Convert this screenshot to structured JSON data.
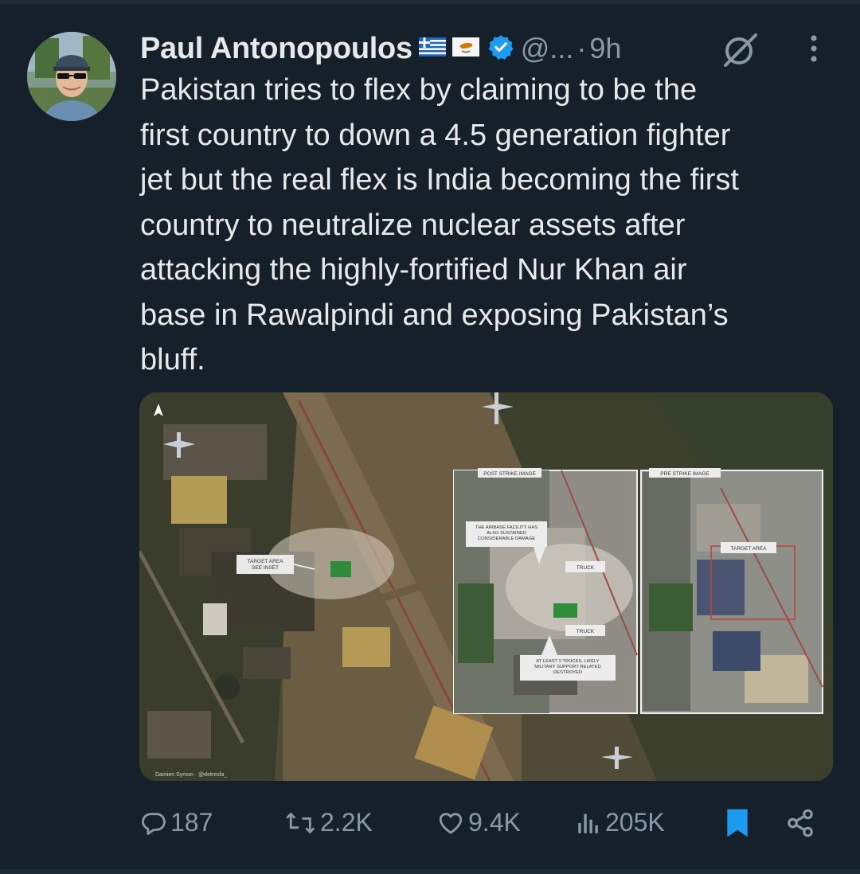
{
  "author": {
    "name": "Paul Antonopoulos",
    "handle": "@...",
    "separator": "·",
    "time": "9h",
    "flags": [
      "greece-flag-icon",
      "cyprus-flag-icon"
    ],
    "verified_icon": "verified-badge-icon"
  },
  "tweet": {
    "text": "Pakistan tries to flex by claiming to be the\nfirst country to down a 4.5 generation fighter\njet but the real flex is India becoming the first\ncountry to neutralize nuclear assets after\nattacking the highly-fortified Nur Khan air\nbase in Rawalpindi and exposing Pakistan’s\nbluff."
  },
  "media": {
    "inset_post_label": "POST STRIKE IMAGE",
    "inset_pre_label": "PRE STRIKE IMAGE",
    "target_area_see_inset": "TARGET AREA\nSEE INSET",
    "target_area": "TARGET AREA",
    "airbase_damage_note": "THE AIRBASE FACILITY HAS\nALSO SUSTAINED\nCONSIDERABLE DAMAGE",
    "truck_1": "TRUCK",
    "truck_2": "TRUCK",
    "trucks_note": "AT LEAST 2 TRUCKS, LIKELY\nMILITARY SUPPORT RELATED\nDESTROYED",
    "credit": "Damien Symon · @detresfa_"
  },
  "actions": {
    "replies": "187",
    "reposts": "2.2K",
    "likes": "9.4K",
    "views": "205K",
    "bookmark_color": "#1d9bf0",
    "icons": [
      "reply-icon",
      "repost-icon",
      "like-icon",
      "views-icon",
      "bookmark-icon",
      "share-icon"
    ]
  }
}
